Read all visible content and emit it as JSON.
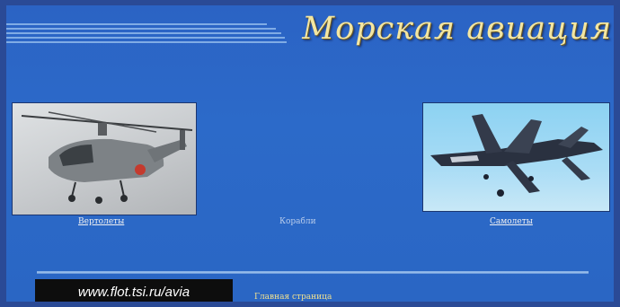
{
  "header": {
    "title": "Морская авиация"
  },
  "sections": {
    "helicopters_label": "Вертолеты",
    "ships_label": "Корабли",
    "aircraft_label": "Самолеты"
  },
  "footer": {
    "url": "www.flot.tsi.ru/avia",
    "home_label": "Главная страница"
  },
  "colors": {
    "background": "#2c6ac9",
    "title": "#f3e6a2",
    "link": "#f2f2f2",
    "muted_link": "#b9cdec",
    "url_box": "#0d0d0d"
  },
  "icons": {
    "helicopter_photo": "helicopter-photo",
    "jet_photo": "jet-photo"
  }
}
